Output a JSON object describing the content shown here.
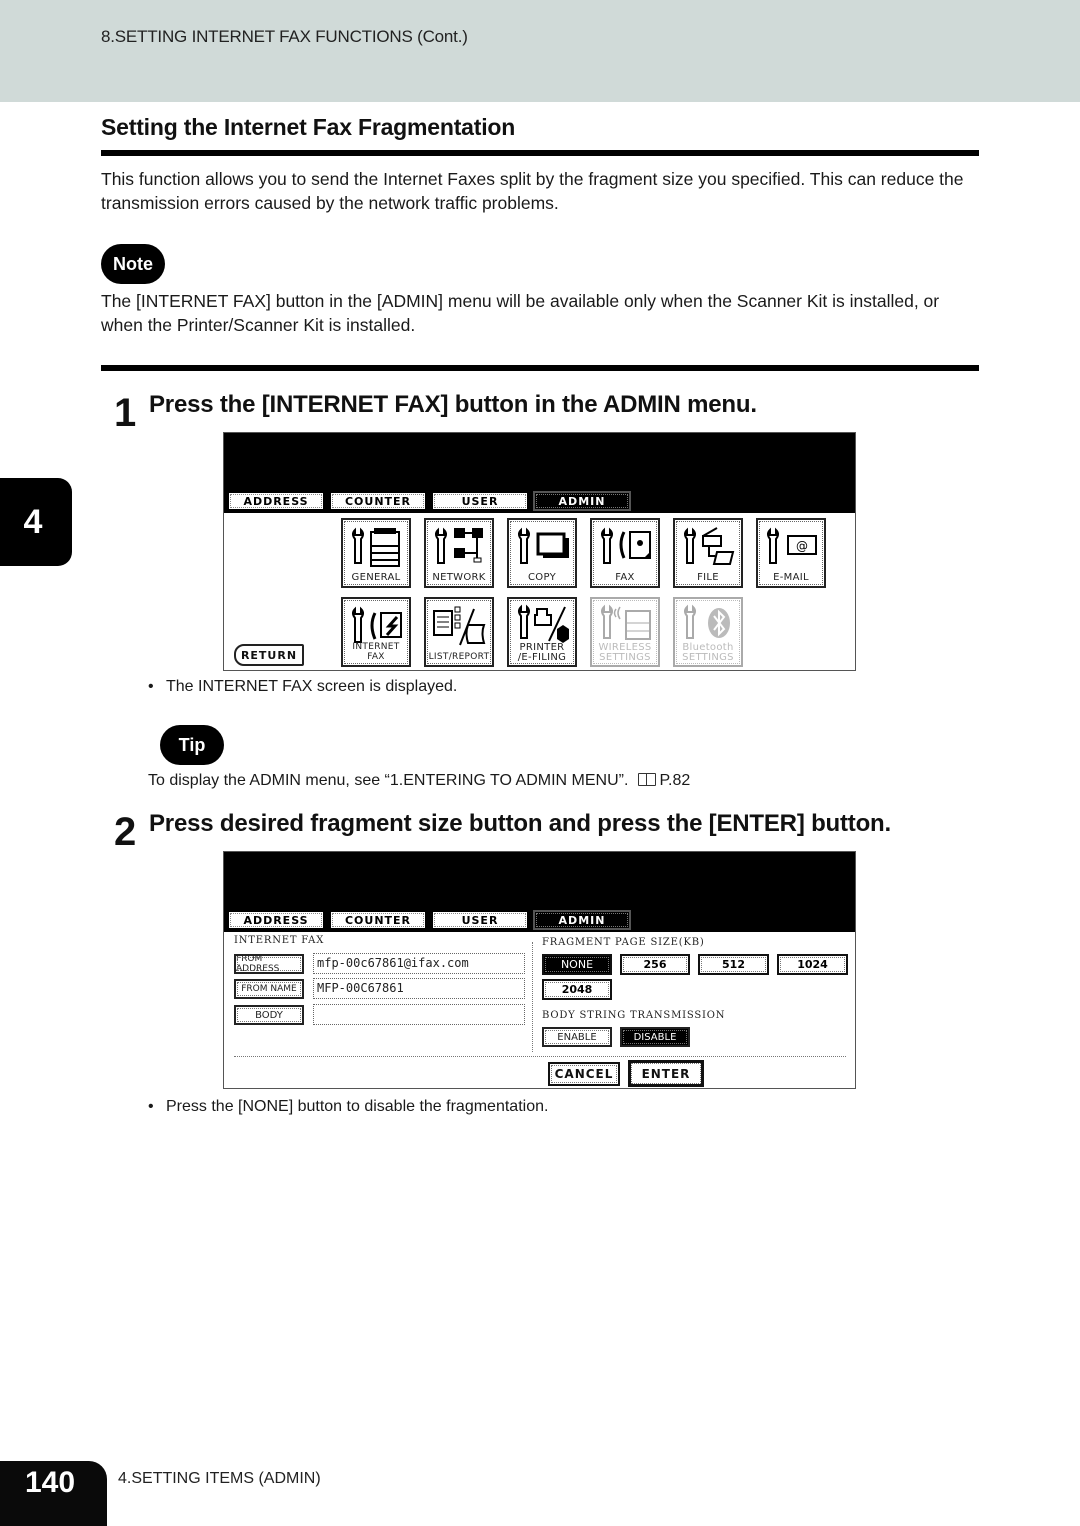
{
  "header": {
    "running_title": "8.SETTING INTERNET FAX FUNCTIONS (Cont.)"
  },
  "section": {
    "title": "Setting the Internet Fax Fragmentation",
    "intro": "This function allows you to send the Internet Faxes split by the fragment size you specified.  This can reduce the transmission errors caused by the network traffic problems."
  },
  "note": {
    "badge": "Note",
    "text": "The [INTERNET FAX] button in the [ADMIN] menu will be available only when the Scanner Kit is installed, or when the Printer/Scanner Kit is installed."
  },
  "side_tab": {
    "chapter": "4"
  },
  "step1": {
    "number": "1",
    "title": "Press the [INTERNET FAX] button in the ADMIN menu.",
    "bullet": "The INTERNET FAX screen is displayed."
  },
  "panel1": {
    "tabs": [
      "ADDRESS",
      "COUNTER",
      "USER",
      "ADMIN"
    ],
    "active_tab": "ADMIN",
    "buttons": [
      {
        "label": "GENERAL",
        "icon": "copier-icon",
        "enabled": true
      },
      {
        "label": "NETWORK",
        "icon": "network-icon",
        "enabled": true
      },
      {
        "label": "COPY",
        "icon": "copy-icon",
        "enabled": true
      },
      {
        "label": "FAX",
        "icon": "fax-icon",
        "enabled": true
      },
      {
        "label": "FILE",
        "icon": "file-folder-icon",
        "enabled": true
      },
      {
        "label": "E-MAIL",
        "icon": "email-icon",
        "enabled": true
      },
      {
        "label": "INTERNET FAX",
        "icon": "internet-fax-icon",
        "enabled": true
      },
      {
        "label": "LIST/REPORT",
        "icon": "list-report-icon",
        "enabled": true
      },
      {
        "label_line1": "PRINTER",
        "label_line2": "/E-FILING",
        "icon": "printer-efiling-icon",
        "enabled": true
      },
      {
        "label_line1": "WIRELESS",
        "label_line2": "SETTINGS",
        "icon": "wireless-icon",
        "enabled": false
      },
      {
        "label_line1": "Bluetooth",
        "label_line2": "SETTINGS",
        "icon": "bluetooth-icon",
        "enabled": false
      }
    ],
    "return_label": "RETURN"
  },
  "tip": {
    "badge": "Tip",
    "text": "To display the ADMIN menu, see “1.ENTERING TO ADMIN MENU”.",
    "page_ref": "P.82"
  },
  "step2": {
    "number": "2",
    "title": "Press desired fragment size button and press the [ENTER] button.",
    "bullet": "Press the [NONE] button to disable the fragmentation."
  },
  "panel2": {
    "tabs": [
      "ADDRESS",
      "COUNTER",
      "USER",
      "ADMIN"
    ],
    "active_tab": "ADMIN",
    "screen_title": "INTERNET FAX",
    "from_address_label": "FROM ADDRESS",
    "from_address_value": "mfp-00c67861@ifax.com",
    "from_name_label": "FROM NAME",
    "from_name_value": "MFP-00C67861",
    "body_label": "BODY",
    "body_value": "",
    "fragment_label": "FRAGMENT PAGE SIZE(KB)",
    "fragment_options": [
      "NONE",
      "256",
      "512",
      "1024",
      "2048"
    ],
    "fragment_selected": "NONE",
    "body_string_label": "BODY STRING TRANSMISSION",
    "body_string_options": [
      "ENABLE",
      "DISABLE"
    ],
    "body_string_selected": "DISABLE",
    "cancel_label": "CANCEL",
    "enter_label": "ENTER"
  },
  "footer": {
    "page_number": "140",
    "chapter_title": "4.SETTING ITEMS (ADMIN)"
  }
}
